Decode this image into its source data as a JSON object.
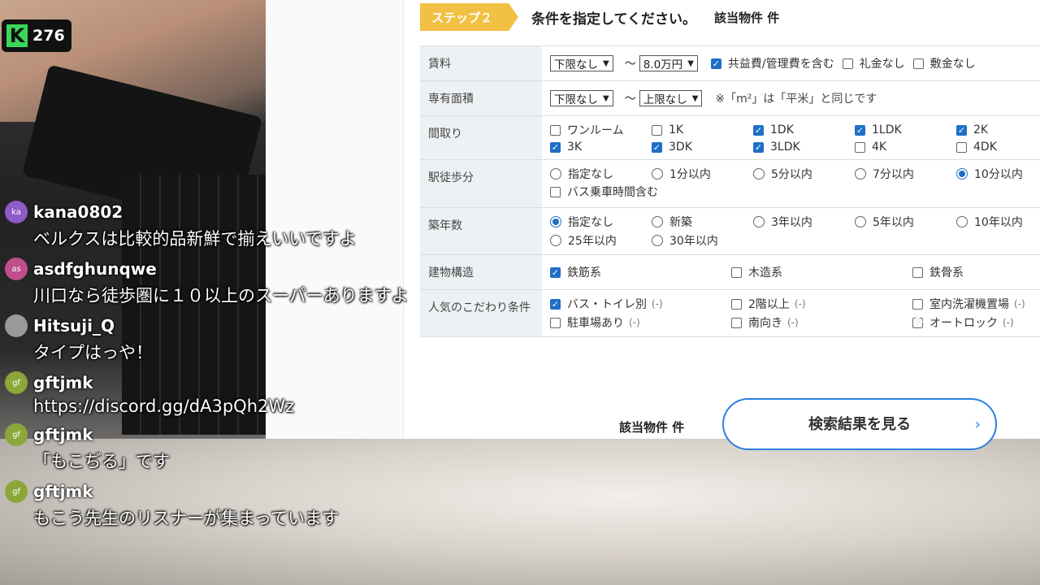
{
  "viewer": {
    "count": "276",
    "icon": "K"
  },
  "step": {
    "badge": "ステップ２",
    "title": "条件を指定してください。",
    "hit_label": "該当物件 件"
  },
  "conditions": {
    "rent": {
      "label": "賃料",
      "min": "下限なし",
      "tilde": "〜",
      "max": "8.0万円",
      "options": [
        {
          "label": "共益費/管理費を含む",
          "checked": true
        },
        {
          "label": "礼金なし",
          "checked": false
        },
        {
          "label": "敷金なし",
          "checked": false
        }
      ]
    },
    "area": {
      "label": "専有面積",
      "min": "下限なし",
      "tilde": "〜",
      "max": "上限なし",
      "note": "※「m²」は「平米」と同じです"
    },
    "layout": {
      "label": "間取り",
      "options": [
        {
          "label": "ワンルーム",
          "checked": false
        },
        {
          "label": "1K",
          "checked": false
        },
        {
          "label": "1DK",
          "checked": true
        },
        {
          "label": "1LDK",
          "checked": true
        },
        {
          "label": "2K",
          "checked": true
        },
        {
          "label": "3K",
          "checked": true
        },
        {
          "label": "3DK",
          "checked": true
        },
        {
          "label": "3LDK",
          "checked": true
        },
        {
          "label": "4K",
          "checked": false
        },
        {
          "label": "4DK",
          "checked": false
        }
      ]
    },
    "walk": {
      "label": "駅徒歩分",
      "options": [
        {
          "label": "指定なし",
          "checked": false
        },
        {
          "label": "1分以内",
          "checked": false
        },
        {
          "label": "5分以内",
          "checked": false
        },
        {
          "label": "7分以内",
          "checked": false
        },
        {
          "label": "10分以内",
          "checked": true
        }
      ],
      "bus": {
        "label": "バス乗車時間含む",
        "checked": false
      }
    },
    "age": {
      "label": "築年数",
      "options": [
        {
          "label": "指定なし",
          "checked": true
        },
        {
          "label": "新築",
          "checked": false
        },
        {
          "label": "3年以内",
          "checked": false
        },
        {
          "label": "5年以内",
          "checked": false
        },
        {
          "label": "10年以内",
          "checked": false
        },
        {
          "label": "25年以内",
          "checked": false
        },
        {
          "label": "30年以内",
          "checked": false
        }
      ]
    },
    "structure": {
      "label": "建物構造",
      "options": [
        {
          "label": "鉄筋系",
          "checked": true
        },
        {
          "label": "木造系",
          "checked": false
        },
        {
          "label": "鉄骨系",
          "checked": false
        }
      ]
    },
    "popular": {
      "label": "人気のこだわり条件",
      "options": [
        {
          "label": "バス・トイレ別",
          "count": "(-)",
          "checked": true
        },
        {
          "label": "2階以上",
          "count": "(-)",
          "checked": false
        },
        {
          "label": "室内洗濯機置場",
          "count": "(-)",
          "checked": false
        },
        {
          "label": "駐車場あり",
          "count": "(-)",
          "checked": false
        },
        {
          "label": "南向き",
          "count": "(-)",
          "checked": false
        },
        {
          "label": "オートロック",
          "count": "(-)",
          "checked": false
        }
      ]
    }
  },
  "bottom": {
    "hit_label": "該当物件 件",
    "search_button": "検索結果を見る",
    "chevron": "›"
  },
  "chat": [
    {
      "user": "kana0802",
      "avatar": "ka",
      "avatar_color": "#8e5bc8",
      "text": "ベルクスは比較的品新鮮で揃えいいですよ"
    },
    {
      "user": "asdfghunqwe",
      "avatar": "as",
      "avatar_color": "#c04f8b",
      "text": "川口なら徒歩圏に１０以上のスーパーありますよ"
    },
    {
      "user": "Hitsuji_Q",
      "avatar": "",
      "avatar_color": "#9a9a9a",
      "text": "タイプはっや！"
    },
    {
      "user": "gftjmk",
      "avatar": "gf",
      "avatar_color": "#8da63a",
      "text": "https://discord.gg/dA3pQh2Wz"
    },
    {
      "user": "gftjmk",
      "avatar": "gf",
      "avatar_color": "#8da63a",
      "text": "「もこぢる」です"
    },
    {
      "user": "gftjmk",
      "avatar": "gf",
      "avatar_color": "#8da63a",
      "text": "もこう先生のリスナーが集まっています"
    }
  ]
}
